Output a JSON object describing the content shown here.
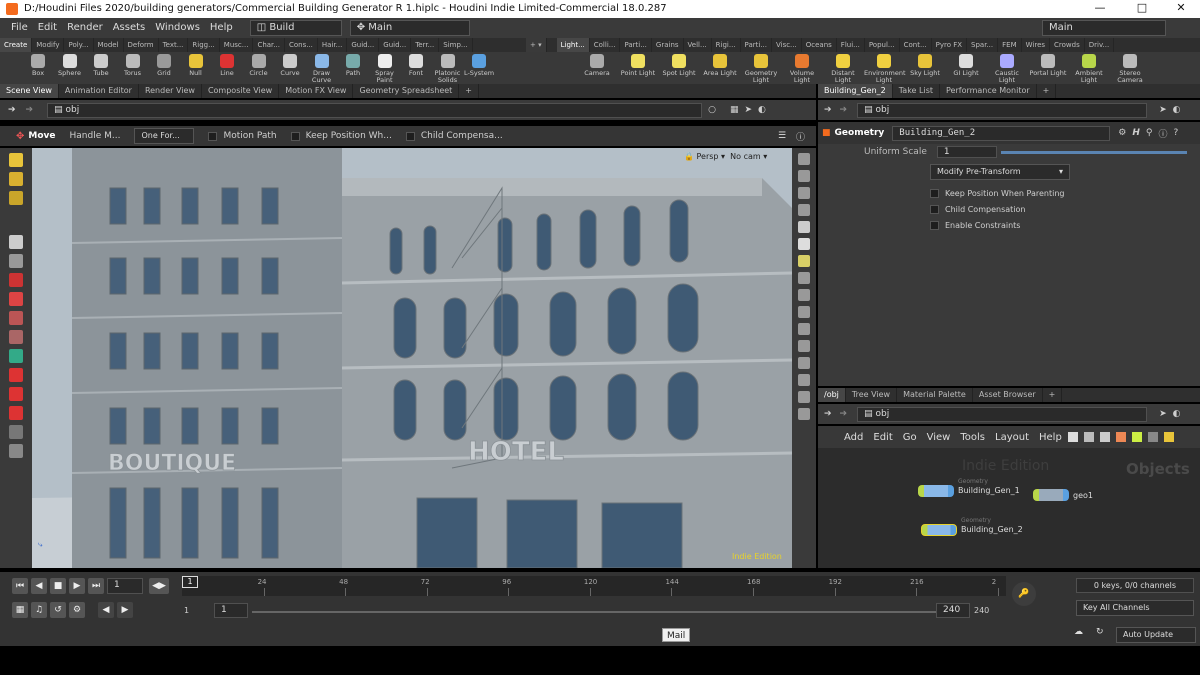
{
  "window": {
    "title": "D:/Houdini Files 2020/building generators/Commercial Building Generator R 1.hiplc - Houdini Indie Limited-Commercial 18.0.287"
  },
  "menu": {
    "items": [
      "File",
      "Edit",
      "Render",
      "Assets",
      "Windows",
      "Help"
    ],
    "desktop": "Build",
    "network": "Main",
    "right_desktop": "Main"
  },
  "shelf_tabs_left": [
    "Create",
    "Modify",
    "Poly...",
    "Model",
    "Deform",
    "Text...",
    "Rigg...",
    "Musc...",
    "Char...",
    "Cons...",
    "Hair...",
    "Guid...",
    "Guid...",
    "Terr...",
    "Simp..."
  ],
  "shelf_tabs_right": [
    "Light...",
    "Colli...",
    "Parti...",
    "Grains",
    "Vell...",
    "Rigi...",
    "Parti...",
    "Visc...",
    "Oceans",
    "Flui...",
    "Popul...",
    "Cont...",
    "Pyro FX",
    "Spar...",
    "FEM",
    "Wires",
    "Crowds",
    "Driv..."
  ],
  "tools_left": [
    "Box",
    "Sphere",
    "Tube",
    "Torus",
    "Grid",
    "Null",
    "Line",
    "Circle",
    "Curve",
    "Draw Curve",
    "Path",
    "Spray Paint",
    "Font",
    "Platonic Solids",
    "L-System"
  ],
  "tools_right": [
    "Camera",
    "Point Light",
    "Spot Light",
    "Area Light",
    "Geometry Light",
    "Volume Light",
    "Distant Light",
    "Environment Light",
    "Sky Light",
    "GI Light",
    "Caustic Light",
    "Portal Light",
    "Ambient Light",
    "Stereo Camera"
  ],
  "viewer": {
    "tabs": [
      "Scene View",
      "Animation Editor",
      "Render View",
      "Composite View",
      "Motion FX View",
      "Geometry Spreadsheet"
    ],
    "path": "obj",
    "tool_name": "Move",
    "handle_mode": "Handle M...",
    "transform_mode": "One For...",
    "motion_path": "Motion Path",
    "keep_position": "Keep Position Wh...",
    "child_compensate": "Child Compensa...",
    "persp": "Persp",
    "cam": "No cam",
    "watermark": "Indie Edition",
    "sign_left": "BOUTIQUE",
    "sign_right": "HOTEL"
  },
  "params": {
    "tabs": [
      "Building_Gen_2",
      "Take List",
      "Performance Monitor"
    ],
    "path": "obj",
    "node_type": "Geometry",
    "node_name": "Building_Gen_2",
    "uniform_scale_label": "Uniform Scale",
    "uniform_scale_value": "1",
    "pre_transform": "Modify Pre-Transform",
    "checkboxes": [
      "Keep Position When Parenting",
      "Child Compensation",
      "Enable Constraints"
    ]
  },
  "network": {
    "tabs": [
      "/obj",
      "Tree View",
      "Material Palette",
      "Asset Browser"
    ],
    "path": "obj",
    "menu": [
      "Add",
      "Edit",
      "Go",
      "View",
      "Tools",
      "Layout",
      "Help"
    ],
    "watermark": "Indie Edition",
    "context_label": "Objects",
    "nodes": [
      {
        "type": "Geometry",
        "name": "Building_Gen_1"
      },
      {
        "type": "",
        "name": "geo1"
      },
      {
        "type": "Geometry",
        "name": "Building_Gen_2"
      }
    ]
  },
  "timeline": {
    "current_frame": "1",
    "frame_marker": "1",
    "ticks": [
      "24",
      "48",
      "72",
      "96",
      "120",
      "144",
      "168",
      "192",
      "216",
      "2"
    ],
    "range_start": "1",
    "range_start2": "1",
    "range_end": "240",
    "range_end2": "240",
    "keys_info": "0 keys, 0/0 channels",
    "key_all": "Key All Channels",
    "auto_update": "Auto Update",
    "tooltip": "Mail"
  },
  "colors": {
    "accent_orange": "#f46b1e",
    "node_green": "#b8d64a",
    "node_blue": "#5aa0e0",
    "panel": "#3a3a3a"
  }
}
